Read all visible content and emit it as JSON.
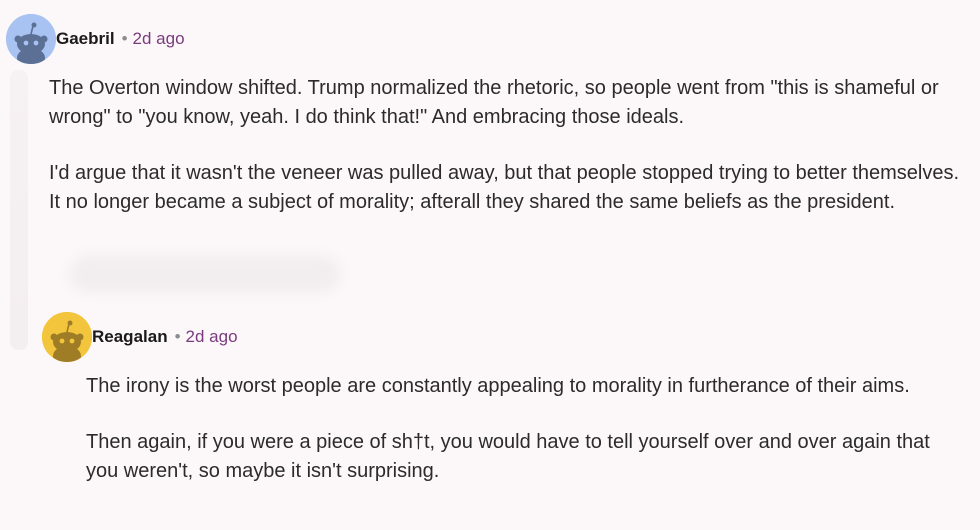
{
  "comments": [
    {
      "username": "Gaebril",
      "separator": "•",
      "time": "2d ago",
      "paragraphs": [
        "The Overton window shifted. Trump normalized the rhetoric, so people went from \"this is shameful or wrong\" to \"you know, yeah. I do think that!\" And embracing those ideals.",
        "I'd argue that it wasn't the veneer was pulled away, but that people stopped trying to better themselves. It no longer became a subject of morality; afterall they shared the same beliefs as the president."
      ],
      "avatar_color": "#a8c3f2"
    },
    {
      "username": "Reagalan",
      "separator": "•",
      "time": "2d ago",
      "paragraphs": [
        "The irony is the worst people are constantly appealing to morality in furtherance of their aims.",
        "Then again, if you were a piece of sh†t, you would have to tell yourself over and over again that you weren't, so maybe it isn't surprising."
      ],
      "avatar_color": "#f2c53d"
    }
  ]
}
